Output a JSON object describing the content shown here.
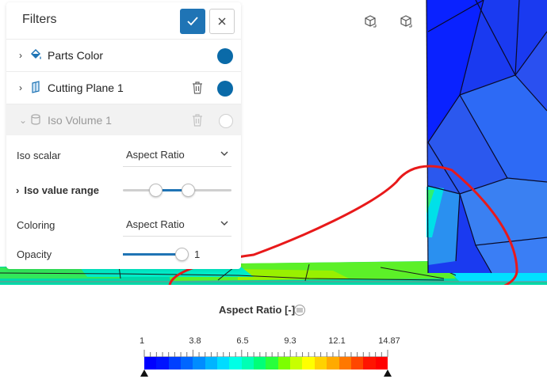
{
  "panel": {
    "title": "Filters",
    "apply_icon": "check-icon",
    "close_icon": "close-icon",
    "filters": [
      {
        "label": "Parts Color",
        "icon": "paint-bucket-icon",
        "enabled": true
      },
      {
        "label": "Cutting Plane 1",
        "icon": "cutting-plane-icon",
        "enabled": true
      },
      {
        "label": "Iso Volume 1",
        "icon": "cylinder-icon",
        "enabled": false
      }
    ],
    "iso": {
      "iso_scalar_label": "Iso scalar",
      "iso_scalar_value": "Aspect Ratio",
      "iso_range_label": "Iso value range",
      "iso_range_low": 0.3,
      "iso_range_high": 0.6,
      "coloring_label": "Coloring",
      "coloring_value": "Aspect Ratio",
      "opacity_label": "Opacity",
      "opacity_value": "1"
    }
  },
  "legend": {
    "title": "Aspect Ratio [-]",
    "ticks": [
      "1",
      "3.8",
      "6.5",
      "9.3",
      "12.1",
      "14.87"
    ],
    "colors": [
      "#0000ff",
      "#0014ff",
      "#0040ff",
      "#0066ff",
      "#008cff",
      "#00b4ff",
      "#00dcff",
      "#00ffe6",
      "#00ffb4",
      "#00ff78",
      "#28ff3c",
      "#7cff00",
      "#c8ff00",
      "#ffff00",
      "#ffd200",
      "#ffaa00",
      "#ff7800",
      "#ff4600",
      "#ff1400",
      "#ff0000"
    ]
  },
  "view_buttons": [
    "cube-view-icon",
    "cube-view-icon"
  ]
}
